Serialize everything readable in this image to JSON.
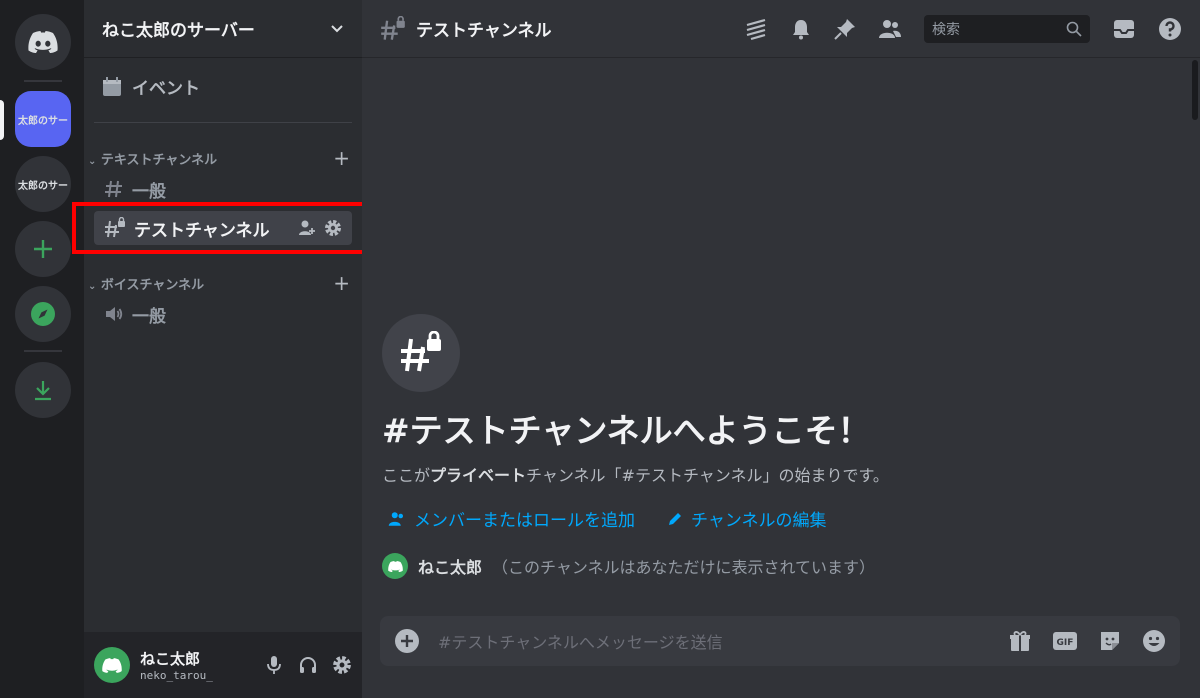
{
  "rail": {
    "servers": [
      {
        "label": "太郎のサー"
      },
      {
        "label": "太郎のサー"
      }
    ]
  },
  "sidebar": {
    "server_name": "ねこ太郎のサーバー",
    "event_label": "イベント",
    "categories": [
      {
        "label": "テキストチャンネル"
      },
      {
        "label": "ボイスチャンネル"
      }
    ],
    "channels": [
      {
        "label": "一般"
      },
      {
        "label": "テストチャンネル"
      },
      {
        "label": "一般"
      }
    ]
  },
  "user": {
    "name": "ねこ太郎",
    "handle": "neko_tarou_"
  },
  "header": {
    "channel_title": "テストチャンネル",
    "search_placeholder": "検索"
  },
  "welcome": {
    "title": "#テストチャンネルへようこそ！",
    "desc_prefix": "ここが",
    "desc_bold": "プライベート",
    "desc_suffix": "チャンネル「#テストチャンネル」の始まりです。",
    "link_add": "メンバーまたはロールを追加",
    "link_edit": "チャンネルの編集",
    "sys_name": "ねこ太郎",
    "sys_note": "（このチャンネルはあなただけに表示されています）"
  },
  "composer": {
    "placeholder": "#テストチャンネルへメッセージを送信",
    "gif_label": "GIF"
  },
  "colors": {
    "accent": "#5865f2",
    "green": "#3ba55d",
    "link": "#00a8fc",
    "highlight": "#ff0000"
  }
}
